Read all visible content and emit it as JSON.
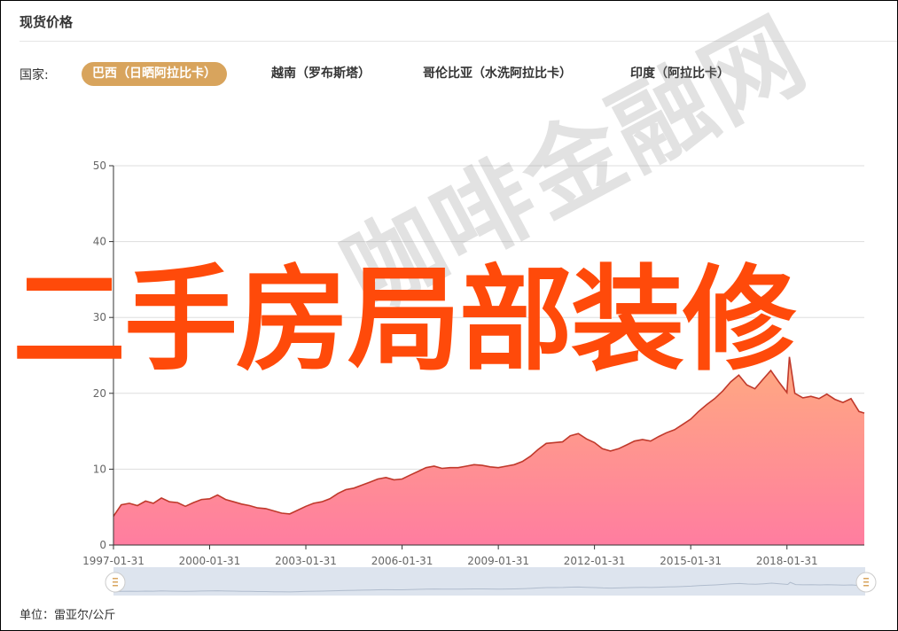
{
  "header": {
    "title": "现货价格"
  },
  "country_filter": {
    "label": "国家:",
    "tabs": [
      {
        "label": "巴西（日晒阿拉比卡）",
        "active": true
      },
      {
        "label": "越南（罗布斯塔）",
        "active": false
      },
      {
        "label": "哥伦比亚（水洗阿拉比卡）",
        "active": false
      },
      {
        "label": "印度（阿拉比卡）",
        "active": false
      }
    ]
  },
  "unit_label": "单位：雷亚尔/公斤",
  "watermark_text": "咖啡金融网",
  "overlay_text": "二手房局部装修",
  "colors": {
    "accent": "#d8a45d",
    "line": "#c0392b",
    "area_top": "#ffaa80",
    "area_bottom": "#ff7da0",
    "overlay": "#ff4a0a"
  },
  "chart_data": {
    "type": "area",
    "title": "",
    "xlabel": "",
    "ylabel": "",
    "ylim": [
      0,
      50
    ],
    "yticks": [
      0,
      10,
      20,
      30,
      40,
      50
    ],
    "xlim": [
      "1997-01-31",
      "2020-06-30"
    ],
    "xticks": [
      "1997-01-31",
      "2000-01-31",
      "2003-01-31",
      "2006-01-31",
      "2009-01-31",
      "2012-01-31",
      "2015-01-31",
      "2018-01-31"
    ],
    "grid": true,
    "series": [
      {
        "x": [
          "1997-01-31",
          "1997-04-30",
          "1997-07-31",
          "1997-10-31",
          "1998-01-31",
          "1998-04-30",
          "1998-07-31",
          "1998-10-31",
          "1999-01-31",
          "1999-04-30",
          "1999-07-31",
          "1999-10-31",
          "2000-01-31",
          "2000-04-30",
          "2000-07-31",
          "2000-10-31",
          "2001-01-31",
          "2001-04-30",
          "2001-07-31",
          "2001-10-31",
          "2002-01-31",
          "2002-04-30",
          "2002-07-31",
          "2002-10-31",
          "2003-01-31",
          "2003-04-30",
          "2003-07-31",
          "2003-10-31",
          "2004-01-31",
          "2004-04-30",
          "2004-07-31",
          "2004-10-31",
          "2005-01-31",
          "2005-04-30",
          "2005-07-31",
          "2005-10-31",
          "2006-01-31",
          "2006-04-30",
          "2006-07-31",
          "2006-10-31",
          "2007-01-31",
          "2007-04-30",
          "2007-07-31",
          "2007-10-31",
          "2008-01-31",
          "2008-04-30",
          "2008-07-31",
          "2008-10-31",
          "2009-01-31",
          "2009-04-30",
          "2009-07-31",
          "2009-10-31",
          "2010-01-31",
          "2010-04-30",
          "2010-07-31",
          "2010-10-31",
          "2011-01-31",
          "2011-04-30",
          "2011-07-31",
          "2011-10-31",
          "2012-01-31",
          "2012-04-30",
          "2012-07-31",
          "2012-10-31",
          "2013-01-31",
          "2013-04-30",
          "2013-07-31",
          "2013-10-31",
          "2014-01-31",
          "2014-04-30",
          "2014-07-31",
          "2014-10-31",
          "2015-01-31",
          "2015-04-30",
          "2015-07-31",
          "2015-10-31",
          "2016-01-31",
          "2016-04-30",
          "2016-07-31",
          "2016-10-31",
          "2017-01-31",
          "2017-04-30",
          "2017-07-31",
          "2017-10-31",
          "2018-01-31",
          "2018-02-28",
          "2018-04-30",
          "2018-07-31",
          "2018-10-31",
          "2019-01-31",
          "2019-04-30",
          "2019-07-31",
          "2019-10-31",
          "2020-01-31",
          "2020-04-30",
          "2020-06-30"
        ],
        "y": [
          3.8,
          5.3,
          5.5,
          5.2,
          5.8,
          5.5,
          6.2,
          5.7,
          5.6,
          5.1,
          5.6,
          6.0,
          6.1,
          6.6,
          6.0,
          5.7,
          5.4,
          5.2,
          4.9,
          4.8,
          4.5,
          4.2,
          4.1,
          4.6,
          5.1,
          5.5,
          5.7,
          6.1,
          6.8,
          7.3,
          7.5,
          7.9,
          8.3,
          8.7,
          8.9,
          8.6,
          8.7,
          9.2,
          9.7,
          10.2,
          10.4,
          10.1,
          10.2,
          10.2,
          10.4,
          10.6,
          10.5,
          10.3,
          10.2,
          10.4,
          10.6,
          11.0,
          11.7,
          12.6,
          13.4,
          13.5,
          13.6,
          14.4,
          14.7,
          14.0,
          13.5,
          12.7,
          12.4,
          12.7,
          13.2,
          13.7,
          13.9,
          13.7,
          14.3,
          14.8,
          15.2,
          15.9,
          16.6,
          17.6,
          18.5,
          19.3,
          20.3,
          21.5,
          22.4,
          21.1,
          20.6,
          21.8,
          23.0,
          21.5,
          20.1,
          24.8,
          20.0,
          19.4,
          19.6,
          19.3,
          19.9,
          19.2,
          18.8,
          19.3,
          17.6,
          17.4
        ]
      }
    ]
  }
}
